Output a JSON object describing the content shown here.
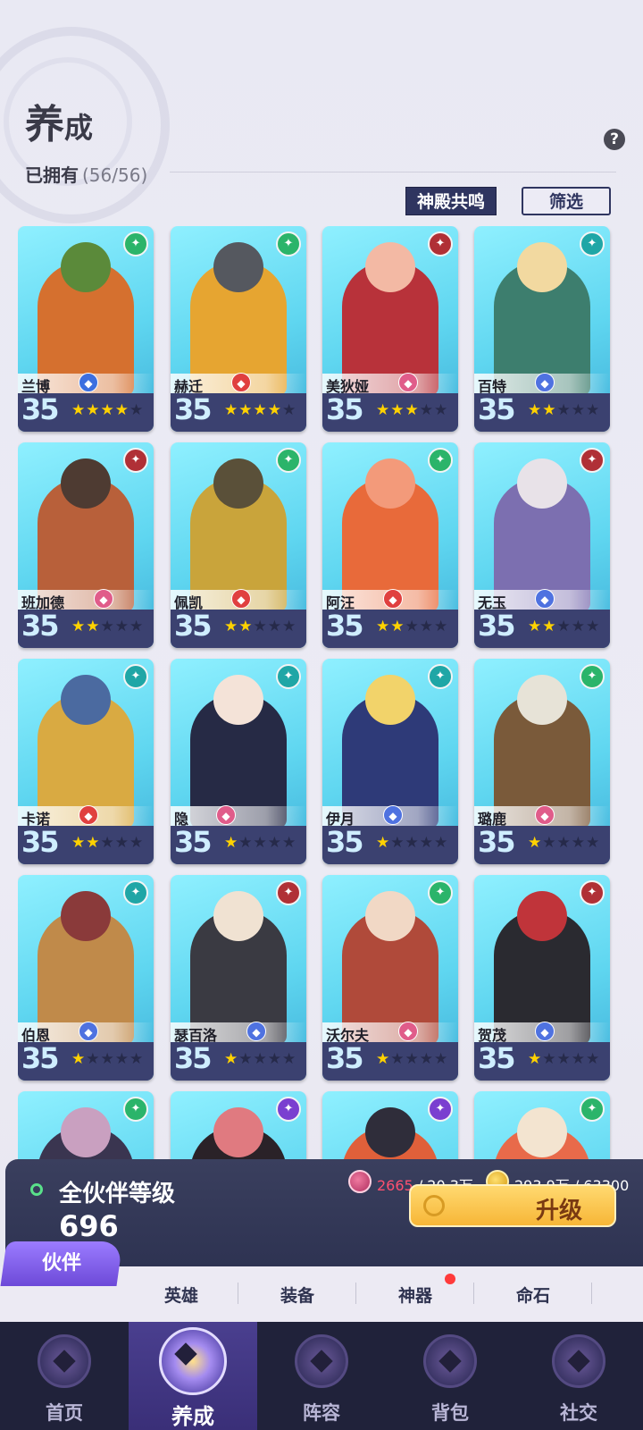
{
  "header": {
    "title_big": "养",
    "title_small": "成",
    "owned_label": "已拥有",
    "owned_count": "(56/56)",
    "help_icon": "?",
    "resonance_button": "神殿共鸣",
    "filter_button": "筛选"
  },
  "heroes": [
    {
      "name": "兰博",
      "level": "35",
      "stars": 4,
      "faction": "nature",
      "faction_color": "#2bb46a",
      "class_color": "#3c6fe0",
      "palette": [
        "#d5702f",
        "#5b8a3a"
      ]
    },
    {
      "name": "赫迁",
      "level": "35",
      "stars": 4,
      "faction": "nature",
      "faction_color": "#2bb46a",
      "class_color": "#e0403f",
      "palette": [
        "#e6a531",
        "#55585f"
      ]
    },
    {
      "name": "美狄娅",
      "level": "35",
      "stars": 3,
      "faction": "chaos",
      "faction_color": "#b03036",
      "class_color": "#e05c8a",
      "palette": [
        "#b8323a",
        "#f3b9a4"
      ]
    },
    {
      "name": "百特",
      "level": "35",
      "stars": 2,
      "faction": "order",
      "faction_color": "#1fa6a6",
      "class_color": "#4f72e0",
      "palette": [
        "#3d7e6e",
        "#f2d9a0"
      ]
    },
    {
      "name": "班加德",
      "level": "35",
      "stars": 2,
      "faction": "chaos",
      "faction_color": "#b03036",
      "class_color": "#e05c8a",
      "palette": [
        "#b8603a",
        "#4e3b32"
      ]
    },
    {
      "name": "佩凯",
      "level": "35",
      "stars": 2,
      "faction": "nature",
      "faction_color": "#2bb46a",
      "class_color": "#e0403f",
      "palette": [
        "#c9a43b",
        "#5a5039"
      ]
    },
    {
      "name": "阿汪",
      "level": "35",
      "stars": 2,
      "faction": "nature",
      "faction_color": "#2bb46a",
      "class_color": "#e0403f",
      "palette": [
        "#e86a3a",
        "#f39a7a"
      ]
    },
    {
      "name": "无玉",
      "level": "35",
      "stars": 2,
      "faction": "chaos",
      "faction_color": "#b03036",
      "class_color": "#4f72e0",
      "palette": [
        "#7c6fb0",
        "#e8e2e8"
      ]
    },
    {
      "name": "卡诺",
      "level": "35",
      "stars": 2,
      "faction": "order",
      "faction_color": "#1fa6a6",
      "class_color": "#e0403f",
      "palette": [
        "#d9aa42",
        "#4b6aa0"
      ]
    },
    {
      "name": "隐",
      "level": "35",
      "stars": 1,
      "faction": "order",
      "faction_color": "#1fa6a6",
      "class_color": "#e05c8a",
      "palette": [
        "#262a45",
        "#f4e3d8"
      ]
    },
    {
      "name": "伊月",
      "level": "35",
      "stars": 1,
      "faction": "order",
      "faction_color": "#1fa6a6",
      "class_color": "#4f72e0",
      "palette": [
        "#2e3a78",
        "#f2d36a"
      ]
    },
    {
      "name": "璐鹿",
      "level": "35",
      "stars": 1,
      "faction": "nature",
      "faction_color": "#2bb46a",
      "class_color": "#e05c8a",
      "palette": [
        "#7a5a3a",
        "#e7e3d7"
      ]
    },
    {
      "name": "伯恩",
      "level": "35",
      "stars": 1,
      "faction": "order",
      "faction_color": "#1fa6a6",
      "class_color": "#4f72e0",
      "palette": [
        "#c08a4a",
        "#8a3a3a"
      ]
    },
    {
      "name": "瑟百洛",
      "level": "35",
      "stars": 1,
      "faction": "chaos",
      "faction_color": "#b03036",
      "class_color": "#4f72e0",
      "palette": [
        "#3a3a42",
        "#f0e2d2"
      ]
    },
    {
      "name": "沃尔夫",
      "level": "35",
      "stars": 1,
      "faction": "nature",
      "faction_color": "#2bb46a",
      "class_color": "#e05c8a",
      "palette": [
        "#b04a3a",
        "#f1d8c5"
      ]
    },
    {
      "name": "贺茂",
      "level": "35",
      "stars": 1,
      "faction": "chaos",
      "faction_color": "#b03036",
      "class_color": "#4f72e0",
      "palette": [
        "#2a2a30",
        "#c0343a"
      ]
    },
    {
      "name": "",
      "level": "",
      "stars": 0,
      "faction": "nature",
      "faction_color": "#2bb46a",
      "class_color": "#4f72e0",
      "palette": [
        "#3a3550",
        "#c9a0c0"
      ]
    },
    {
      "name": "",
      "level": "",
      "stars": 0,
      "faction": "void",
      "faction_color": "#7a3fd0",
      "class_color": "#4f72e0",
      "palette": [
        "#2a2228",
        "#e07a80"
      ]
    },
    {
      "name": "",
      "level": "",
      "stars": 0,
      "faction": "void",
      "faction_color": "#7a3fd0",
      "class_color": "#4f72e0",
      "palette": [
        "#e0603a",
        "#2f2d3a"
      ]
    },
    {
      "name": "",
      "level": "",
      "stars": 0,
      "faction": "nature",
      "faction_color": "#2bb46a",
      "class_color": "#4f72e0",
      "palette": [
        "#e86a4a",
        "#f3e4d0"
      ]
    }
  ],
  "panel": {
    "label": "全伙伴等级",
    "value": "696",
    "resource1_current": "2665",
    "resource1_total": "/ 20.3万",
    "resource2": "293.9万 / 63300",
    "upgrade_button": "升级"
  },
  "subtabs": {
    "active": "伙伴",
    "items": [
      "英雄",
      "装备",
      "神器",
      "命石"
    ]
  },
  "nav": {
    "items": [
      "首页",
      "养成",
      "阵容",
      "背包",
      "社交"
    ],
    "active_index": 1
  },
  "colors": {
    "card_bottom": "#3b4170",
    "star_on": "#ffd200",
    "accent_purple": "#6d4ad8",
    "upgrade_gold": "#f7b637"
  }
}
